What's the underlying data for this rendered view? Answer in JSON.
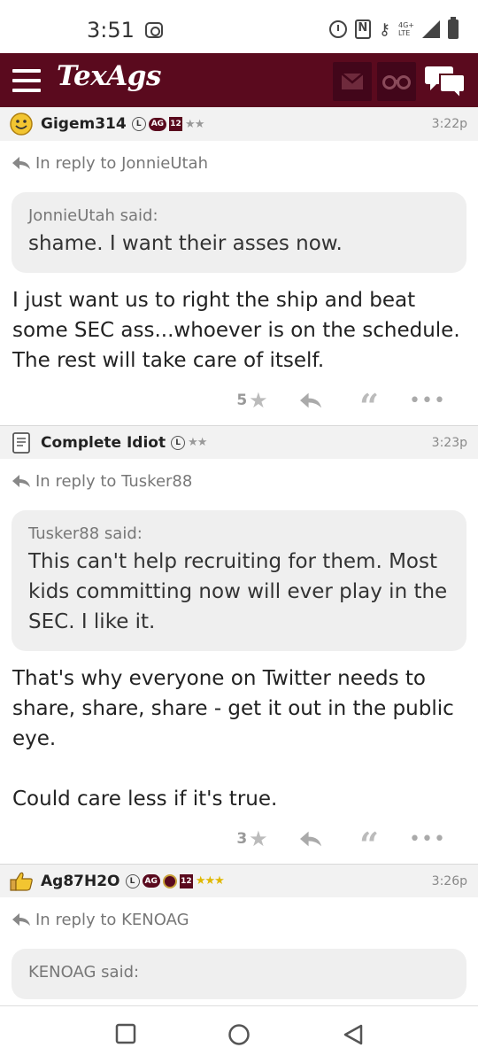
{
  "status_bar": {
    "time": "3:51",
    "network": "4G+",
    "network_sub": "LTE"
  },
  "header": {
    "logo": "TexAgs",
    "brand_color": "#5a0a1e"
  },
  "posts": [
    {
      "username": "Gigem314",
      "badges": [
        "L",
        "AG",
        "12"
      ],
      "stars": "★★",
      "time": "3:22p",
      "reply_to": "In reply to JonnieUtah",
      "quote_author": "JonnieUtah said:",
      "quote_text": "shame. I want their asses now.",
      "body": "I just want us to right the ship and beat some SEC ass...whoever is on the schedule. The rest will take care of itself.",
      "star_count": "5"
    },
    {
      "username": "Complete Idiot",
      "badges": [
        "L"
      ],
      "stars": "★★",
      "time": "3:23p",
      "reply_to": "In reply to Tusker88",
      "quote_author": "Tusker88 said:",
      "quote_text": "This can't help recruiting for them. Most kids committing now will ever play in the SEC. I like it.",
      "body": "That's why everyone on Twitter needs to share, share, share - get it out in the public eye.\n\nCould care less if it's true.",
      "star_count": "3"
    },
    {
      "username": "Ag87H2O",
      "badges": [
        "L",
        "AG",
        "12"
      ],
      "stars": "★★★",
      "time": "3:26p",
      "reply_to": "In reply to KENOAG",
      "quote_author": "KENOAG said:"
    }
  ]
}
